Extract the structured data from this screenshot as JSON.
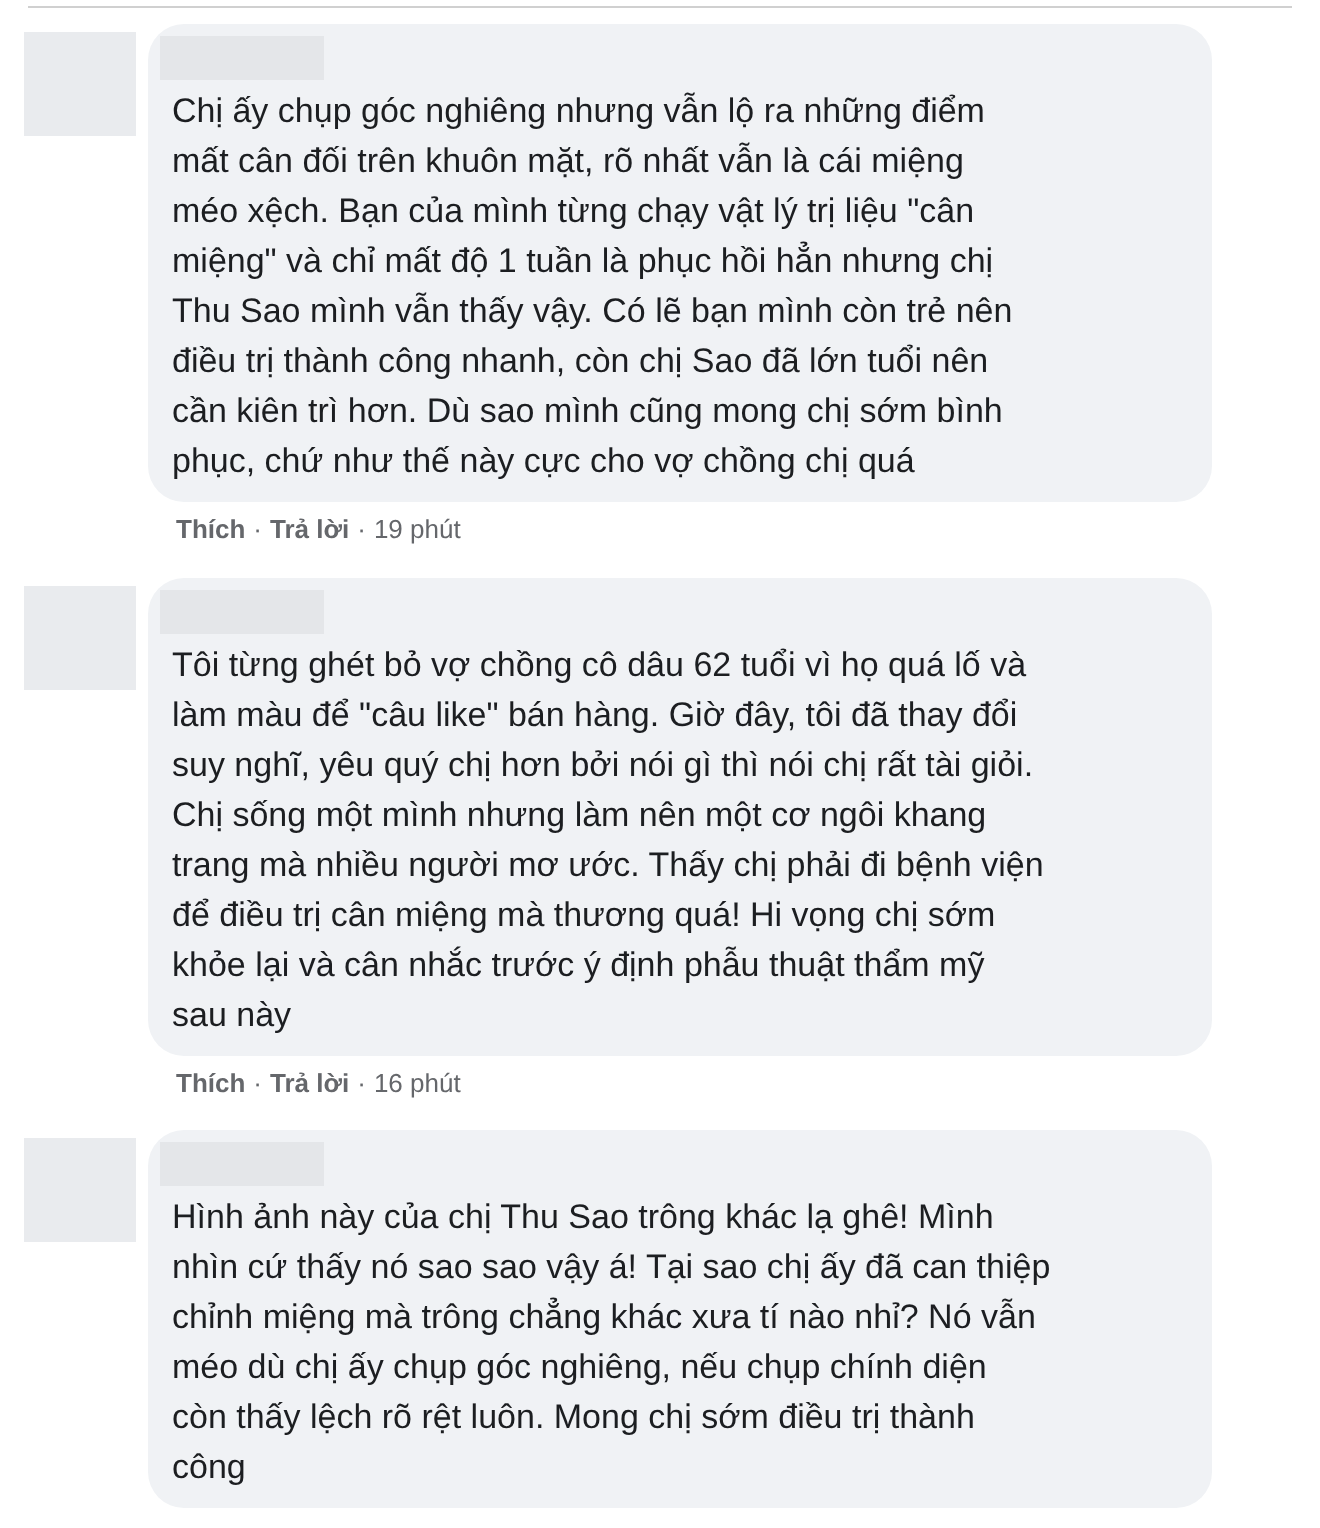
{
  "comments": [
    {
      "lines": [
        "Chị ấy chụp góc nghiêng nhưng vẫn lộ ra những điểm",
        "mất cân đối trên khuôn mặt, rõ nhất vẫn là cái miệng",
        "méo xệch. Bạn của mình từng chạy vật lý trị liệu \"cân",
        "miệng\" và chỉ mất độ 1 tuần là phục hồi hẳn nhưng chị",
        "Thu Sao mình vẫn thấy vậy. Có lẽ bạn mình còn trẻ nên",
        "điều trị thành công nhanh, còn chị Sao đã lớn tuổi nên",
        "cần kiên trì hơn. Dù sao mình cũng mong chị sớm bình",
        "phục, chứ như thế này cực cho vợ chồng chị quá"
      ],
      "like": "Thích",
      "sep1": "·",
      "reply": "Trả lời",
      "sep2": "·",
      "time": "19 phút"
    },
    {
      "lines": [
        "Tôi từng ghét bỏ vợ chồng cô dâu 62 tuổi vì họ quá lố và",
        "làm màu để \"câu like\" bán hàng. Giờ đây, tôi đã thay đổi",
        "suy nghĩ, yêu quý chị hơn bởi nói gì thì nói chị rất tài giỏi.",
        "Chị sống một mình nhưng làm nên một cơ ngôi khang",
        "trang mà nhiều người mơ ước. Thấy chị phải đi bệnh viện",
        "để điều trị cân miệng mà thương quá! Hi vọng chị sớm",
        "khỏe lại và cân nhắc trước ý định phẫu thuật thẩm mỹ",
        "sau này"
      ],
      "like": "Thích",
      "sep1": "·",
      "reply": "Trả lời",
      "sep2": "·",
      "time": "16 phút"
    },
    {
      "lines": [
        "Hình ảnh này của chị Thu Sao trông khác lạ ghê! Mình",
        "nhìn cứ thấy nó sao sao vậy á! Tại sao chị ấy đã can thiệp",
        "chỉnh miệng mà trông chẳng khác xưa tí nào nhỉ? Nó vẫn",
        "méo dù chị ấy chụp góc nghiêng, nếu chụp chính diện",
        "còn thấy lệch rõ rệt luôn. Mong chị sớm điều trị thành",
        "công"
      ]
    }
  ]
}
